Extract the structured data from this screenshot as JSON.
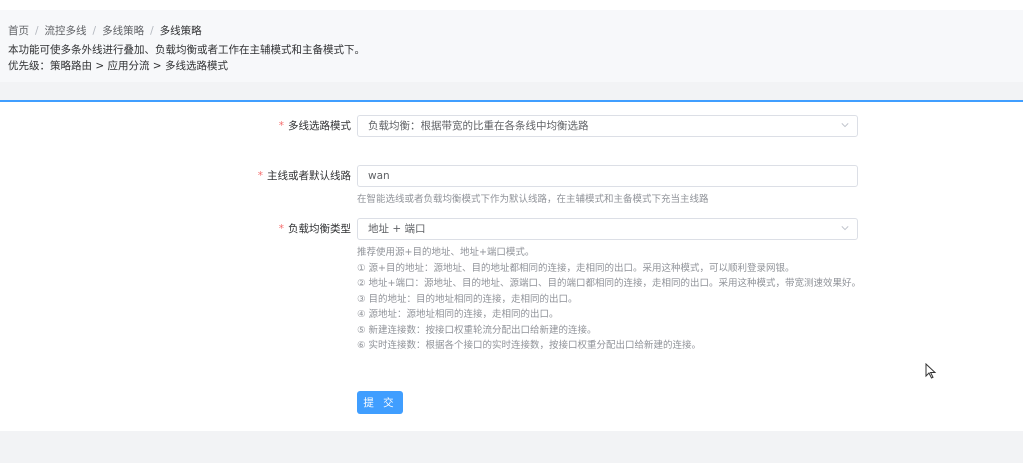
{
  "breadcrumb": {
    "items": [
      "首页",
      "流控多线",
      "多线策略",
      "多线策略"
    ],
    "separator": "/"
  },
  "description": {
    "line1": "本功能可使多条外线进行叠加、负载均衡或者工作在主辅模式和主备模式下。",
    "line2": "优先级：策略路由 > 应用分流 > 多线选路模式"
  },
  "form": {
    "mode": {
      "label": "多线选路模式",
      "value": "负载均衡：根据带宽的比重在各条线中均衡选路"
    },
    "default_line": {
      "label": "主线或者默认线路",
      "value": "wan",
      "help": "在智能选线或者负载均衡模式下作为默认线路，在主辅模式和主备模式下充当主线路"
    },
    "lb_type": {
      "label": "负载均衡类型",
      "value": "地址 + 端口",
      "help": [
        "推荐使用源+目的地址、地址+端口模式。",
        "① 源+目的地址：源地址、目的地址都相同的连接，走相同的出口。采用这种模式，可以顺利登录网银。",
        "② 地址+端口：源地址、目的地址、源端口、目的端口都相同的连接，走相同的出口。采用这种模式，带宽测速效果好。",
        "③ 目的地址：目的地址相同的连接，走相同的出口。",
        "④ 源地址：源地址相同的连接，走相同的出口。",
        "⑤ 新建连接数：按接口权重轮流分配出口给新建的连接。",
        "⑥ 实时连接数：根据各个接口的实时连接数，按接口权重分配出口给新建的连接。"
      ]
    },
    "required_mark": "*",
    "submit_label": "提 交"
  },
  "icons": {
    "select_arrow": "chevron-down-icon",
    "cursor": "mouse-pointer-icon"
  },
  "colors": {
    "primary": "#409eff",
    "required": "#f56c6c"
  }
}
